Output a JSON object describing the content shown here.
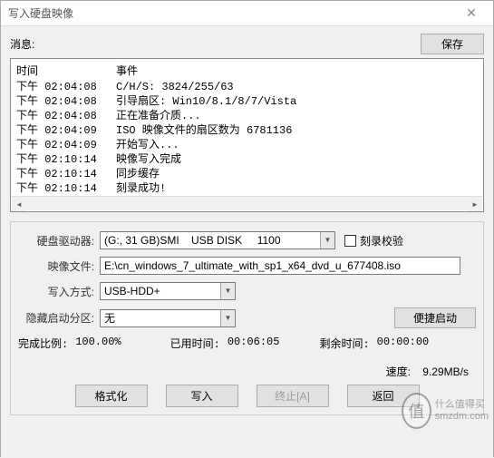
{
  "window": {
    "title": "写入硬盘映像",
    "close": "✕"
  },
  "msg": {
    "label": "消息:",
    "save_btn": "保存"
  },
  "log": {
    "headers": {
      "time": "时间",
      "event": "事件"
    },
    "rows": [
      {
        "time": "下午 02:04:08",
        "event": "C/H/S: 3824/255/63"
      },
      {
        "time": "下午 02:04:08",
        "event": "引导扇区: Win10/8.1/8/7/Vista"
      },
      {
        "time": "下午 02:04:08",
        "event": "正在准备介质..."
      },
      {
        "time": "下午 02:04:09",
        "event": "ISO 映像文件的扇区数为 6781136"
      },
      {
        "time": "下午 02:04:09",
        "event": "开始写入..."
      },
      {
        "time": "下午 02:10:14",
        "event": "映像写入完成"
      },
      {
        "time": "下午 02:10:14",
        "event": "同步缓存"
      },
      {
        "time": "下午 02:10:14",
        "event": "刻录成功!"
      }
    ]
  },
  "fields": {
    "drive": {
      "label": "硬盘驱动器:",
      "value": "(G:, 31 GB)SMI    USB DISK     1100"
    },
    "verify": {
      "label": "刻录校验"
    },
    "image": {
      "label": "映像文件:",
      "value": "E:\\cn_windows_7_ultimate_with_sp1_x64_dvd_u_677408.iso"
    },
    "write_mode": {
      "label": "写入方式:",
      "value": "USB-HDD+"
    },
    "hidden_boot": {
      "label": "隐藏启动分区:",
      "value": "无",
      "btn": "便捷启动"
    }
  },
  "status": {
    "done_label": "完成比例:",
    "done_value": "100.00%",
    "elapsed_label": "已用时间:",
    "elapsed_value": "00:06:05",
    "remain_label": "剩余时间:",
    "remain_value": "00:00:00",
    "speed_label": "速度:",
    "speed_value": "9.29MB/s"
  },
  "buttons": {
    "format": "格式化",
    "write": "写入",
    "abort": "终止[A]",
    "back": "返回"
  },
  "watermark": {
    "glyph": "值",
    "line1": "什么值得买",
    "line2": "smzdm.com"
  }
}
